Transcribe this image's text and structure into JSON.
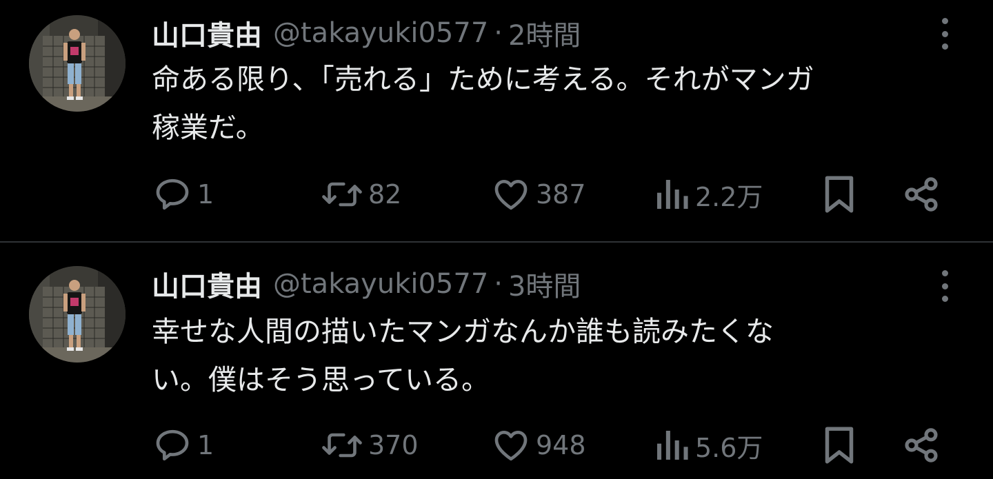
{
  "colors": {
    "background": "#000000",
    "text_primary": "#e7e9ea",
    "text_secondary": "#71767b",
    "divider": "#2f3336"
  },
  "tweets": [
    {
      "author_name": "山口貴由",
      "handle": "@takayuki0577",
      "separator": "·",
      "time": "2時間",
      "text_lines": [
        "命ある限り、「売れる」ために考える。それがマンガ",
        "稼業だ。"
      ],
      "replies": "1",
      "retweets": "82",
      "likes": "387",
      "views": "2.2万"
    },
    {
      "author_name": "山口貴由",
      "handle": "@takayuki0577",
      "separator": "·",
      "time": "3時間",
      "text_lines": [
        "幸せな人間の描いたマンガなんか誰も読みたくな",
        "い。僕はそう思っている。"
      ],
      "replies": "1",
      "retweets": "370",
      "likes": "948",
      "views": "5.6万"
    }
  ],
  "icons": {
    "reply": "reply-bubble-icon",
    "retweet": "retweet-arrows-icon",
    "like": "heart-icon",
    "views": "bar-chart-icon",
    "bookmark": "bookmark-icon",
    "share": "share-icon",
    "more": "more-vertical-icon"
  }
}
